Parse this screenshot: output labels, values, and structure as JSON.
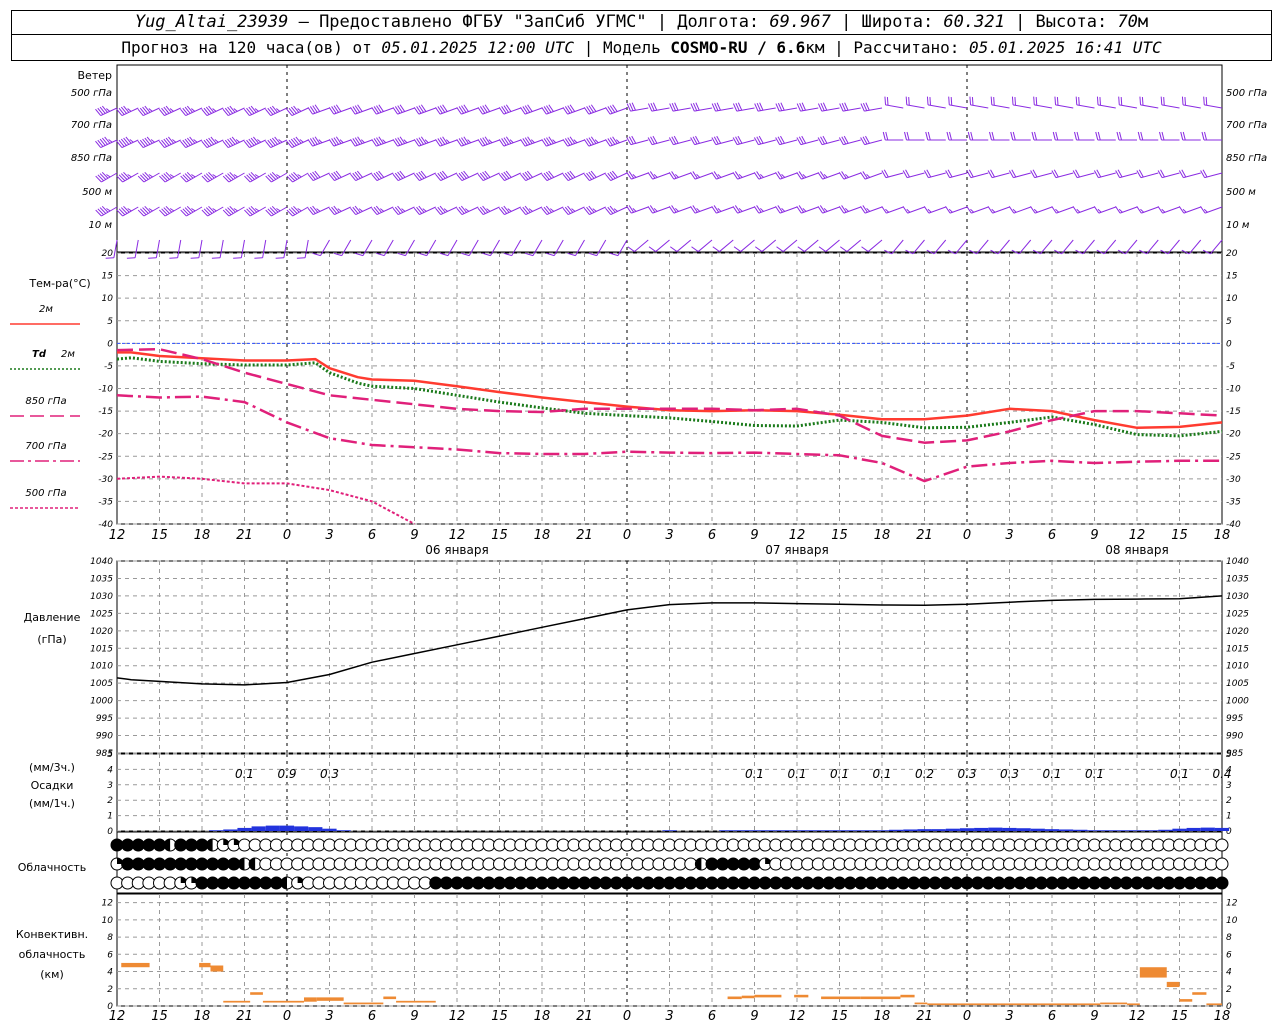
{
  "header": {
    "station": "Yug_Altai_23939",
    "provider": " – Предоставлено ФГБУ \"ЗапСиб УГМС\" | Долгота: ",
    "lon": "69.967",
    "lat_label": " | Широта: ",
    "lat": "60.321",
    "alt_label": " | Высота: ",
    "alt": "70",
    "alt_unit": "м",
    "forecast_label": "Прогноз на 120 часа(ов) от ",
    "forecast_date": "05.01.2025 12:00 UTC",
    "model_label": "  | Модель ",
    "model": "COSMO-RU / 6.6",
    "model_unit": "км",
    "calc_label": " | Рассчитано: ",
    "calc_date": "05.01.2025 16:41 UTC"
  },
  "panels": {
    "wind": {
      "title": "Ветер",
      "levels": [
        "500 гПа",
        "700 гПа",
        "850 гПа",
        "500 м",
        "10 м"
      ],
      "color": "#8a2be2"
    },
    "temp": {
      "title": "Тем-ра(°C)",
      "legend": [
        {
          "label": "2м",
          "color": "#ff3b30",
          "dash": "solid"
        },
        {
          "label": "Td 2м",
          "color": "#1a7a1a",
          "dash": "dotted"
        },
        {
          "label": "850 гПа",
          "color": "#e0207a",
          "dash": "long"
        },
        {
          "label": "700 гПа",
          "color": "#e0207a",
          "dash": "dashdot"
        },
        {
          "label": "500 гПа",
          "color": "#e0207a",
          "dash": "fine"
        }
      ],
      "yticks": [
        "20",
        "15",
        "10",
        "5",
        "0",
        "-5",
        "-10",
        "-15",
        "-20",
        "-25",
        "-30",
        "-35",
        "-40"
      ]
    },
    "pressure": {
      "title": "Давление",
      "unit": "(гПа)",
      "yticks": [
        "1040",
        "1035",
        "1030",
        "1025",
        "1020",
        "1015",
        "1010",
        "1005",
        "1000",
        "995",
        "990",
        "985"
      ]
    },
    "precip": {
      "unit3": "(мм/3ч.)",
      "title": "Осадки",
      "unit1": "(мм/1ч.)",
      "yticks": [
        "5",
        "4",
        "3",
        "2",
        "1",
        "0"
      ],
      "labels": [
        {
          "h": 9,
          "text": "0.1"
        },
        {
          "h": 12,
          "text": "0.9"
        },
        {
          "h": 15,
          "text": "0.3"
        },
        {
          "h": 45,
          "text": "0.1"
        },
        {
          "h": 48,
          "text": "0.1"
        },
        {
          "h": 51,
          "text": "0.1"
        },
        {
          "h": 54,
          "text": "0.1"
        },
        {
          "h": 57,
          "text": "0.2"
        },
        {
          "h": 60,
          "text": "0.3"
        },
        {
          "h": 63,
          "text": "0.3"
        },
        {
          "h": 66,
          "text": "0.1"
        },
        {
          "h": 69,
          "text": "0.1"
        },
        {
          "h": 75,
          "text": "0.1"
        },
        {
          "h": 78,
          "text": "0.4"
        }
      ]
    },
    "cloud": {
      "title": "Облачность"
    },
    "conv": {
      "title1": "Конвективн.",
      "title2": "облачность",
      "unit": "(км)",
      "yticks": [
        "12",
        "10",
        "8",
        "6",
        "4",
        "2",
        "0"
      ]
    }
  },
  "xaxis": {
    "labels": [
      "12",
      "15",
      "18",
      "21",
      "0",
      "3",
      "6",
      "9",
      "12",
      "15",
      "18",
      "21",
      "0",
      "3",
      "6",
      "9",
      "12",
      "15",
      "18",
      "21",
      "0",
      "3",
      "6",
      "9",
      "12",
      "15",
      "18"
    ],
    "dates": [
      {
        "h": 24,
        "text": "06 января"
      },
      {
        "h": 48,
        "text": "07 января"
      },
      {
        "h": 72,
        "text": "08 января"
      }
    ]
  },
  "chart_data": {
    "type": "line",
    "x_hours_from_start": "0..78",
    "temperature": {
      "ylim": [
        -40,
        20
      ],
      "series": [
        {
          "name": "2м",
          "x": [
            0,
            1,
            3,
            6,
            9,
            12,
            14,
            15,
            17,
            18,
            21,
            24,
            27,
            30,
            33,
            36,
            39,
            42,
            45,
            48,
            51,
            54,
            57,
            60,
            63,
            66,
            69,
            72,
            75,
            78
          ],
          "values": [
            -2,
            -2,
            -2.8,
            -3.3,
            -3.8,
            -3.8,
            -3.5,
            -5.5,
            -7.5,
            -8,
            -8.3,
            -9.5,
            -10.8,
            -12,
            -13,
            -14,
            -14.8,
            -15,
            -14.8,
            -15,
            -15.8,
            -16.8,
            -16.8,
            -16,
            -14.5,
            -15,
            -17,
            -18.7,
            -18.5,
            -17.5
          ]
        },
        {
          "name": "Td 2м",
          "x": [
            0,
            1,
            3,
            6,
            9,
            12,
            14,
            15,
            17,
            18,
            21,
            24,
            27,
            30,
            33,
            36,
            39,
            42,
            45,
            48,
            51,
            54,
            57,
            60,
            63,
            66,
            69,
            72,
            75,
            78
          ],
          "values": [
            -3.5,
            -3.2,
            -4,
            -4.5,
            -4.8,
            -4.8,
            -4.3,
            -6.5,
            -8.8,
            -9.5,
            -10,
            -11.5,
            -13,
            -14.3,
            -15.5,
            -16,
            -16.5,
            -17.3,
            -18.2,
            -18.3,
            -17,
            -17.5,
            -18.7,
            -18.6,
            -17.5,
            -16.3,
            -18,
            -20.2,
            -20.5,
            -19.5
          ]
        },
        {
          "name": "850 гПа",
          "x": [
            0,
            3,
            6,
            9,
            12,
            15,
            18,
            21,
            24,
            27,
            30,
            33,
            36,
            39,
            42,
            45,
            48,
            51,
            54,
            57,
            60,
            63,
            66,
            69,
            72,
            75,
            78
          ],
          "values": [
            -1.5,
            -1.3,
            -3.5,
            -6.5,
            -9,
            -11.5,
            -12.5,
            -13.5,
            -14.5,
            -15,
            -15.2,
            -14.5,
            -14.5,
            -14.5,
            -14.5,
            -14.8,
            -14.5,
            -16,
            -20.5,
            -22,
            -21.5,
            -19.5,
            -17,
            -15,
            -15,
            -15.5,
            -16
          ]
        },
        {
          "name": "700 гПа",
          "x": [
            0,
            3,
            6,
            9,
            12,
            15,
            18,
            21,
            24,
            27,
            30,
            33,
            36,
            39,
            42,
            45,
            48,
            51,
            54,
            57,
            60,
            63,
            66,
            69,
            72,
            75,
            78
          ],
          "values": [
            -11.5,
            -12,
            -11.8,
            -13,
            -17.5,
            -21,
            -22.5,
            -23,
            -23.5,
            -24.3,
            -24.5,
            -24.5,
            -24,
            -24.2,
            -24.3,
            -24.2,
            -24.5,
            -24.8,
            -26.5,
            -30.5,
            -27.3,
            -26.5,
            -26,
            -26.5,
            -26.2,
            -26,
            -26
          ]
        },
        {
          "name": "500 гПа",
          "x": [
            0,
            3,
            6,
            9,
            12,
            15,
            18,
            21
          ],
          "values": [
            -30,
            -29.5,
            -30,
            -31,
            -31,
            -32.5,
            -35,
            -40
          ]
        }
      ]
    },
    "pressure": {
      "ylim": [
        985,
        1040
      ],
      "x": [
        0,
        1,
        3,
        6,
        9,
        12,
        15,
        18,
        21,
        24,
        27,
        30,
        33,
        36,
        39,
        42,
        45,
        48,
        51,
        54,
        57,
        60,
        63,
        66,
        69,
        72,
        75,
        78
      ],
      "values": [
        1006.5,
        1006,
        1005.5,
        1004.8,
        1004.5,
        1005.2,
        1007.5,
        1011,
        1013.5,
        1016,
        1018.5,
        1021,
        1023.5,
        1026,
        1027.5,
        1028,
        1028,
        1027.8,
        1027.6,
        1027.4,
        1027.3,
        1027.6,
        1028.2,
        1028.7,
        1029,
        1029.1,
        1029.2,
        1030
      ]
    },
    "precip_mm_per_hour": {
      "ylim": [
        0,
        5
      ],
      "x": [
        7,
        8,
        9,
        10,
        11,
        12,
        13,
        14,
        15,
        16,
        39,
        43,
        44,
        45,
        46,
        47,
        48,
        49,
        50,
        51,
        52,
        53,
        54,
        55,
        56,
        57,
        58,
        59,
        60,
        61,
        62,
        63,
        64,
        65,
        66,
        67,
        68,
        69,
        70,
        71,
        72,
        73,
        74,
        75,
        76,
        77,
        78
      ],
      "values": [
        0.05,
        0.1,
        0.2,
        0.3,
        0.35,
        0.35,
        0.3,
        0.25,
        0.15,
        0.05,
        0.05,
        0.05,
        0.05,
        0.05,
        0.05,
        0.05,
        0.05,
        0.05,
        0.05,
        0.05,
        0.05,
        0.05,
        0.05,
        0.08,
        0.1,
        0.12,
        0.12,
        0.15,
        0.18,
        0.2,
        0.22,
        0.2,
        0.18,
        0.15,
        0.12,
        0.1,
        0.08,
        0.05,
        0.05,
        0.05,
        0.05,
        0.05,
        0.08,
        0.15,
        0.2,
        0.22,
        0.2
      ]
    },
    "cloud_cover_symbols": {
      "rows": 3,
      "codes": [
        "FFFFFHFFFHQQEEEEEEEEEEEEEEEEEEEEEEEEEEEEEEEEEEEEEEEEEEEEEEEEEEEEEEEEEEEEEEEEEEEEEEEEEEEEEEEEEEEEEEEEEEEEEEE",
        "QFFFFFFFFFFFHHEEEEEEEEEEEEEEEEEEEEEEEEEEEEEEEEEEEEEEEEEHFFFFFQEEEEEEEEEEEEEEEEEEEEEEEEEEEEEEEEEEEEEEEEEEEEEEF",
        "EEEEEEQQFFFFFFFFHQEEEEEEEEEEEEFFFFFFFFFFFFFFFFFFFFFFFFFFFFFFFFFFFFFFFFFFFFFFFFFFFFFFFFFFFFFFFFFFFFFFFFFFFFFFF"
      ]
    },
    "convective_cloud_km": {
      "ylim": [
        0,
        13
      ],
      "bars": [
        {
          "h0": 0.3,
          "h1": 2.3,
          "bottom": 4.5,
          "top": 5.0
        },
        {
          "h0": 5.8,
          "h1": 6.6,
          "bottom": 4.5,
          "top": 5.0
        },
        {
          "h0": 6.6,
          "h1": 7.5,
          "bottom": 4.0,
          "top": 4.7
        },
        {
          "h0": 7.5,
          "h1": 9.4,
          "bottom": 0.4,
          "top": 0.6
        },
        {
          "h0": 9.4,
          "h1": 10.3,
          "bottom": 1.3,
          "top": 1.6
        },
        {
          "h0": 10.3,
          "h1": 13.2,
          "bottom": 0.4,
          "top": 0.6
        },
        {
          "h0": 13.2,
          "h1": 14.1,
          "bottom": 0.5,
          "top": 1.0
        },
        {
          "h0": 14.1,
          "h1": 16.0,
          "bottom": 0.6,
          "top": 1.0
        },
        {
          "h0": 16.0,
          "h1": 18.8,
          "bottom": 0.2,
          "top": 0.4
        },
        {
          "h0": 18.8,
          "h1": 19.7,
          "bottom": 0.8,
          "top": 1.1
        },
        {
          "h0": 19.7,
          "h1": 22.5,
          "bottom": 0.4,
          "top": 0.6
        },
        {
          "h0": 43.1,
          "h1": 44.1,
          "bottom": 0.8,
          "top": 1.1
        },
        {
          "h0": 44.1,
          "h1": 45.0,
          "bottom": 0.9,
          "top": 1.2
        },
        {
          "h0": 45.0,
          "h1": 46.9,
          "bottom": 1.0,
          "top": 1.3
        },
        {
          "h0": 47.8,
          "h1": 48.8,
          "bottom": 1.0,
          "top": 1.3
        },
        {
          "h0": 49.7,
          "h1": 52.5,
          "bottom": 0.8,
          "top": 1.1
        },
        {
          "h0": 52.5,
          "h1": 55.3,
          "bottom": 0.8,
          "top": 1.1
        },
        {
          "h0": 55.3,
          "h1": 56.3,
          "bottom": 1.0,
          "top": 1.3
        },
        {
          "h0": 56.3,
          "h1": 57.2,
          "bottom": 0.2,
          "top": 0.4
        },
        {
          "h0": 57.2,
          "h1": 69.4,
          "bottom": 0.1,
          "top": 0.3
        },
        {
          "h0": 69.4,
          "h1": 71.3,
          "bottom": 0.2,
          "top": 0.4
        },
        {
          "h0": 71.3,
          "h1": 72.2,
          "bottom": 0.1,
          "top": 0.3
        },
        {
          "h0": 72.2,
          "h1": 74.1,
          "bottom": 3.3,
          "top": 4.5
        },
        {
          "h0": 74.1,
          "h1": 75.0,
          "bottom": 2.2,
          "top": 2.8
        },
        {
          "h0": 75.0,
          "h1": 75.9,
          "bottom": 0.5,
          "top": 0.8
        },
        {
          "h0": 75.9,
          "h1": 76.9,
          "bottom": 1.3,
          "top": 1.6
        },
        {
          "h0": 76.9,
          "h1": 78.0,
          "bottom": 0.1,
          "top": 0.3
        }
      ]
    },
    "wind_barbs": {
      "levels": [
        "500 гПа",
        "700 гПа",
        "850 гПа",
        "500 м",
        "10 м"
      ],
      "segments": [
        {
          "until_h": 14,
          "dir_deg": [
            245,
            245,
            240,
            240,
            190
          ],
          "speed_kt": [
            45,
            55,
            45,
            45,
            10
          ]
        },
        {
          "until_h": 36,
          "dir_deg": [
            250,
            250,
            245,
            245,
            210
          ],
          "speed_kt": [
            40,
            45,
            40,
            35,
            10
          ]
        },
        {
          "until_h": 55,
          "dir_deg": [
            260,
            255,
            250,
            250,
            230
          ],
          "speed_kt": [
            30,
            30,
            25,
            25,
            10
          ]
        },
        {
          "until_h": 78,
          "dir_deg": [
            280,
            270,
            255,
            250,
            220
          ],
          "speed_kt": [
            20,
            20,
            20,
            15,
            10
          ]
        }
      ]
    }
  }
}
